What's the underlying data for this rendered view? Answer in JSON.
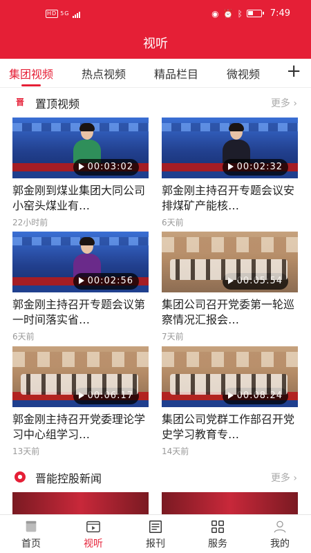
{
  "status_bar": {
    "network": "HD",
    "signal_label": "5G",
    "time": "7:49"
  },
  "header": {
    "title": "视听"
  },
  "tabs": [
    {
      "label": "集团视频",
      "active": true
    },
    {
      "label": "热点视频",
      "active": false
    },
    {
      "label": "精品栏目",
      "active": false
    },
    {
      "label": "微视频",
      "active": false
    }
  ],
  "tabs_add_icon": "plus-icon",
  "section_top": {
    "title": "置顶视频",
    "more": "更多",
    "icon": "晋"
  },
  "videos": [
    {
      "title": "郭金刚到煤业集团大同公司小窑头煤业有…",
      "duration": "00:03:02",
      "time": "22小时前",
      "thumb": "news"
    },
    {
      "title": "郭金刚主持召开专题会议安排煤矿产能核…",
      "duration": "00:02:32",
      "time": "6天前",
      "thumb": "news"
    },
    {
      "title": "郭金刚主持召开专题会议第一时间落实省…",
      "duration": "00:02:56",
      "time": "6天前",
      "thumb": "news"
    },
    {
      "title": "集团公司召开党委第一轮巡察情况汇报会…",
      "duration": "00:05:54",
      "time": "7天前",
      "thumb": "meet"
    },
    {
      "title": "郭金刚主持召开党委理论学习中心组学习…",
      "duration": "00:06:17",
      "time": "13天前",
      "thumb": "meet"
    },
    {
      "title": "集团公司党群工作部召开党史学习教育专…",
      "duration": "00:08:24",
      "time": "14天前",
      "thumb": "meet"
    }
  ],
  "section_news": {
    "title": "晋能控股新闻",
    "more": "更多"
  },
  "bottom_nav": [
    {
      "label": "首页",
      "icon": "home-icon",
      "active": false
    },
    {
      "label": "视听",
      "icon": "video-icon",
      "active": true
    },
    {
      "label": "报刊",
      "icon": "newspaper-icon",
      "active": false
    },
    {
      "label": "服务",
      "icon": "grid-icon",
      "active": false
    },
    {
      "label": "我的",
      "icon": "user-icon",
      "active": false
    }
  ],
  "colors": {
    "brand": "#e51f36",
    "muted": "#999999"
  }
}
